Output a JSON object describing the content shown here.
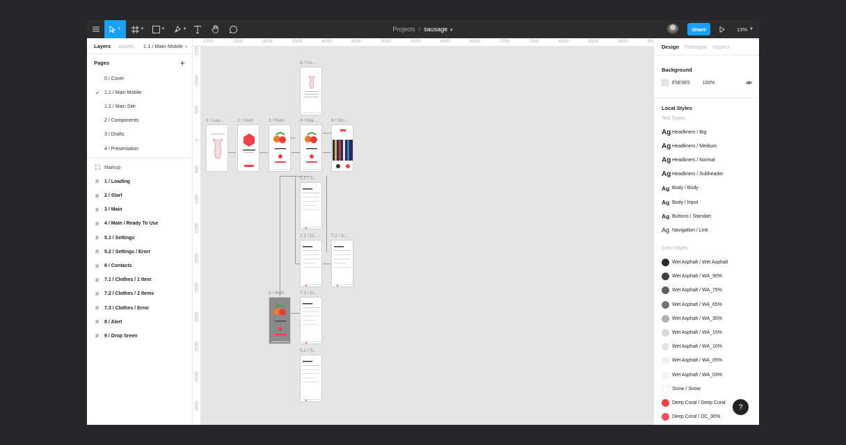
{
  "toolbar": {
    "breadcrumb_projects": "Projects",
    "breadcrumb_sep": "/",
    "file_name": "sausage",
    "share_label": "Share",
    "zoom_label": "13%",
    "accent": "#18a0fb"
  },
  "left_panel": {
    "tab_layers": "Layers",
    "tab_assets": "Assets",
    "current_page": "1.1 / Main Mobile",
    "pages_title": "Pages",
    "pages": [
      "0 / Cover",
      "1.1 / Main Mobile",
      "1.2 / Main Site",
      "2 / Components",
      "3 / Drafts",
      "4 / Presentation"
    ],
    "selected_page_index": 1,
    "markup_label": "Markup",
    "layers": [
      "1 / Loading",
      "2 / Start",
      "3 / Main",
      "4 / Main / Ready To Use",
      "5.1 / Settings",
      "5.2 / Settings / Erorr",
      "6 / Contacts",
      "7.1 / Clothes / 1 Item",
      "7.2 / Clothes / 2 Items",
      "7.3 / Clothes / Error",
      "8 / Alert",
      "9 / Drop Sreen"
    ]
  },
  "ruler": {
    "top": [
      "2000",
      "2500",
      "3000",
      "3500",
      "4000",
      "4500",
      "5000",
      "5500",
      "6000",
      "6500",
      "7000",
      "7500",
      "8000",
      "8500",
      "9000",
      "95"
    ],
    "left": [
      "-1500",
      "-1000",
      "-500",
      "0",
      "500",
      "1000",
      "1500",
      "2000",
      "2500",
      "3000",
      "3500",
      "4000",
      "4500"
    ]
  },
  "canvas": {
    "frames": [
      {
        "label": "6 / Co...",
        "dark": false
      },
      {
        "label": "1 / Loa...",
        "dark": false
      },
      {
        "label": "2 / Start",
        "dark": false
      },
      {
        "label": "3 / Main",
        "dark": false
      },
      {
        "label": "4 / Mai...",
        "dark": false
      },
      {
        "label": "9 / Dro...",
        "dark": false
      },
      {
        "label": "5.1 / S...",
        "dark": false
      },
      {
        "label": "7.1 / Cl...",
        "dark": false
      },
      {
        "label": "7.2 / C...",
        "dark": false
      },
      {
        "label": "8 / Alert",
        "dark": true
      },
      {
        "label": "7.3 / C...",
        "dark": false
      },
      {
        "label": "5.2 / S...",
        "dark": false
      }
    ]
  },
  "right_panel": {
    "tab_design": "Design",
    "tab_prototype": "Prototype",
    "tab_inspect": "Inspect",
    "background_title": "Background",
    "background_hex": "E5E5E5",
    "background_opacity": "100%",
    "local_styles_title": "Local Styles",
    "text_styles_title": "Text Styles",
    "ag": "Ag",
    "text_styles": [
      "Headliners / Big",
      "Headliners / Medium",
      "Headliners / Normal",
      "Headliners / Subheader",
      "Body / Body",
      "Body / Input",
      "Buttons / Standart",
      "Navigation / Link"
    ],
    "color_styles_title": "Color Styles",
    "color_styles": [
      {
        "name": "Wet Asphalt / Wet Asphalt",
        "color": "#2b2b2b"
      },
      {
        "name": "Wet Asphalt / WA_90%",
        "color": "#404040"
      },
      {
        "name": "Wet Asphalt / WA_75%",
        "color": "#606060"
      },
      {
        "name": "Wet Asphalt / WA_65%",
        "color": "#747474"
      },
      {
        "name": "Wet Asphalt / WA_35%",
        "color": "#b0b0b0"
      },
      {
        "name": "Wet Asphalt / WA_15%",
        "color": "#dadada"
      },
      {
        "name": "Wet Asphalt / WA_10%",
        "color": "#e5e5e5"
      },
      {
        "name": "Wet Asphalt / WA_05%",
        "color": "#efefef"
      },
      {
        "name": "Wet Asphalt / WA_03%",
        "color": "#f5f5f5"
      },
      {
        "name": "Snow / Snow",
        "color": "#ffffff"
      },
      {
        "name": "Deep Coral / Deep Coral",
        "color": "#f0404a"
      },
      {
        "name": "Deep Coral / DC_90%",
        "color": "#f25159"
      }
    ]
  },
  "help_label": "?"
}
